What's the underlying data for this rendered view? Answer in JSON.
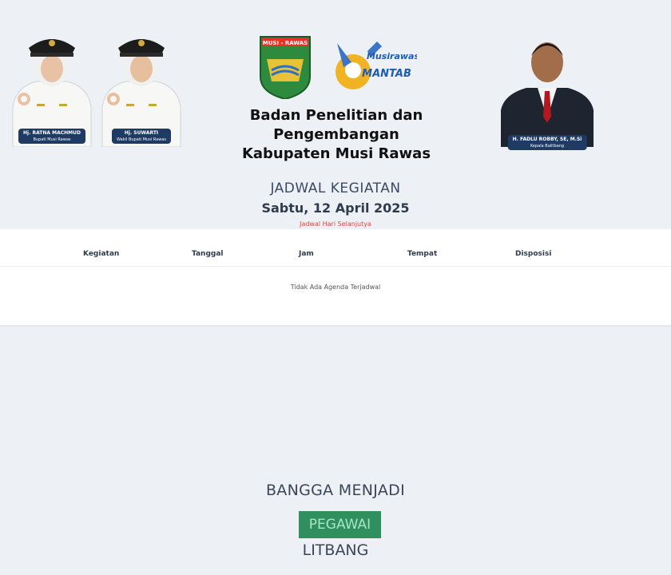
{
  "header": {
    "leaders": [
      {
        "name": "Hj. RATNA MACHMUD",
        "role": "Bupati Musi Rawas"
      },
      {
        "name": "Hj. SUWARTI",
        "role": "Wakil Bupati Musi Rawas"
      },
      {
        "name": "H. FADLU ROBBY, SE, M.Si",
        "role": "Kepala Balitbang"
      }
    ],
    "emblem_text": "MUSI - RAWAS",
    "slogan_line1": "Musirawas",
    "slogan_line2": "MANTAB",
    "org_line1": "Badan Penelitian dan Pengembangan",
    "org_line2": "Kabupaten Musi Rawas"
  },
  "schedule": {
    "title": "JADWAL KEGIATAN",
    "date": "Sabtu, 12 April 2025",
    "next_link": "Jadwal Hari Selanjutya",
    "columns": [
      "Kegiatan",
      "Tanggal",
      "Jam",
      "Tempat",
      "Disposisi"
    ],
    "empty_message": "Tidak Ada Agenda Terjadwal"
  },
  "footer_banner": {
    "line1": "BANGGA MENJADI",
    "highlight": "PEGAWAI",
    "line3": "LITBANG"
  },
  "colors": {
    "background": "#edf1f6",
    "nametag": "#1f3a63",
    "highlight": "#2f8f5f",
    "link": "#e0453a"
  }
}
